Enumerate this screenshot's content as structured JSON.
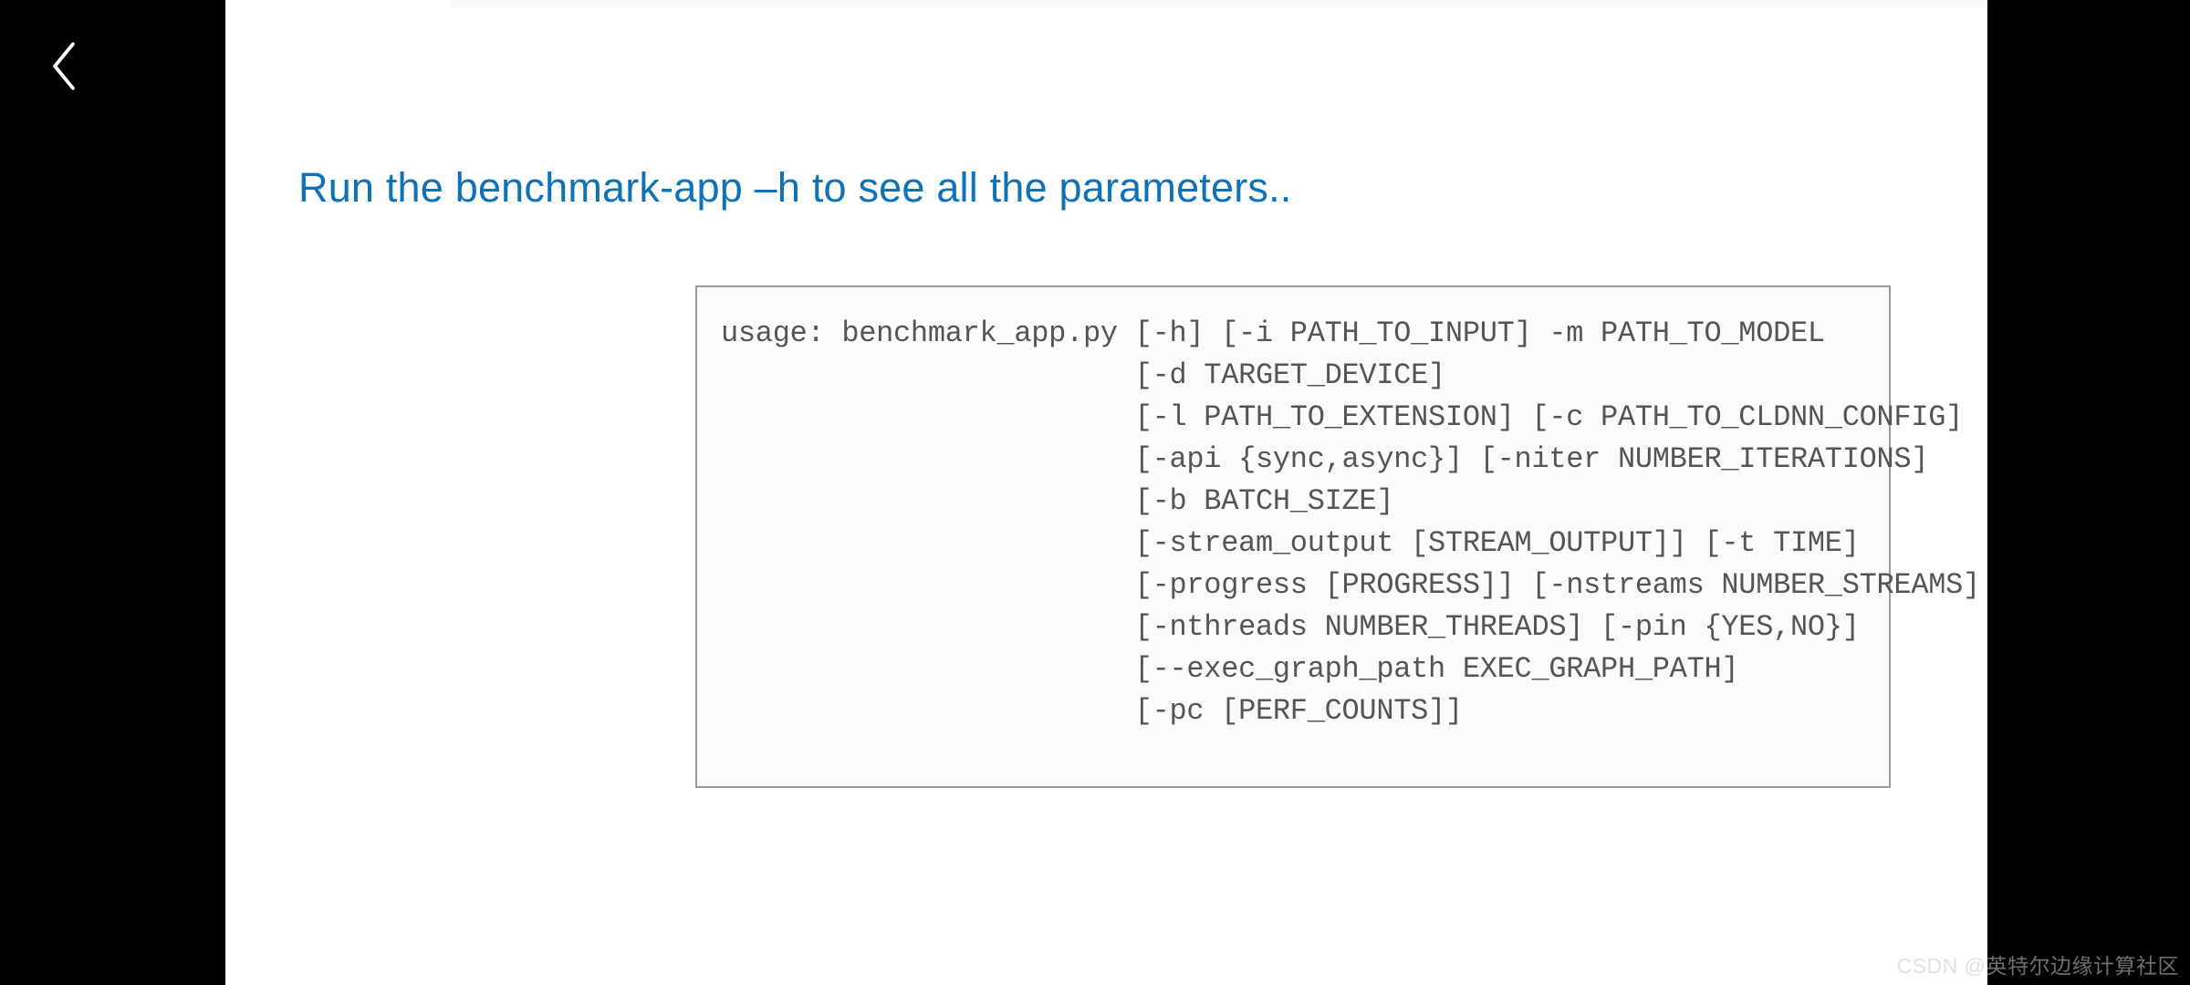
{
  "slide": {
    "title": "Run the benchmark-app –h to see all the parameters..",
    "code": "usage: benchmark_app.py [-h] [-i PATH_TO_INPUT] -m PATH_TO_MODEL\n                        [-d TARGET_DEVICE]\n                        [-l PATH_TO_EXTENSION] [-c PATH_TO_CLDNN_CONFIG]\n                        [-api {sync,async}] [-niter NUMBER_ITERATIONS]\n                        [-b BATCH_SIZE]\n                        [-stream_output [STREAM_OUTPUT]] [-t TIME]\n                        [-progress [PROGRESS]] [-nstreams NUMBER_STREAMS]\n                        [-nthreads NUMBER_THREADS] [-pin {YES,NO}]\n                        [--exec_graph_path EXEC_GRAPH_PATH]\n                        [-pc [PERF_COUNTS]]"
  },
  "watermark": "CSDN @英特尔边缘计算社区"
}
